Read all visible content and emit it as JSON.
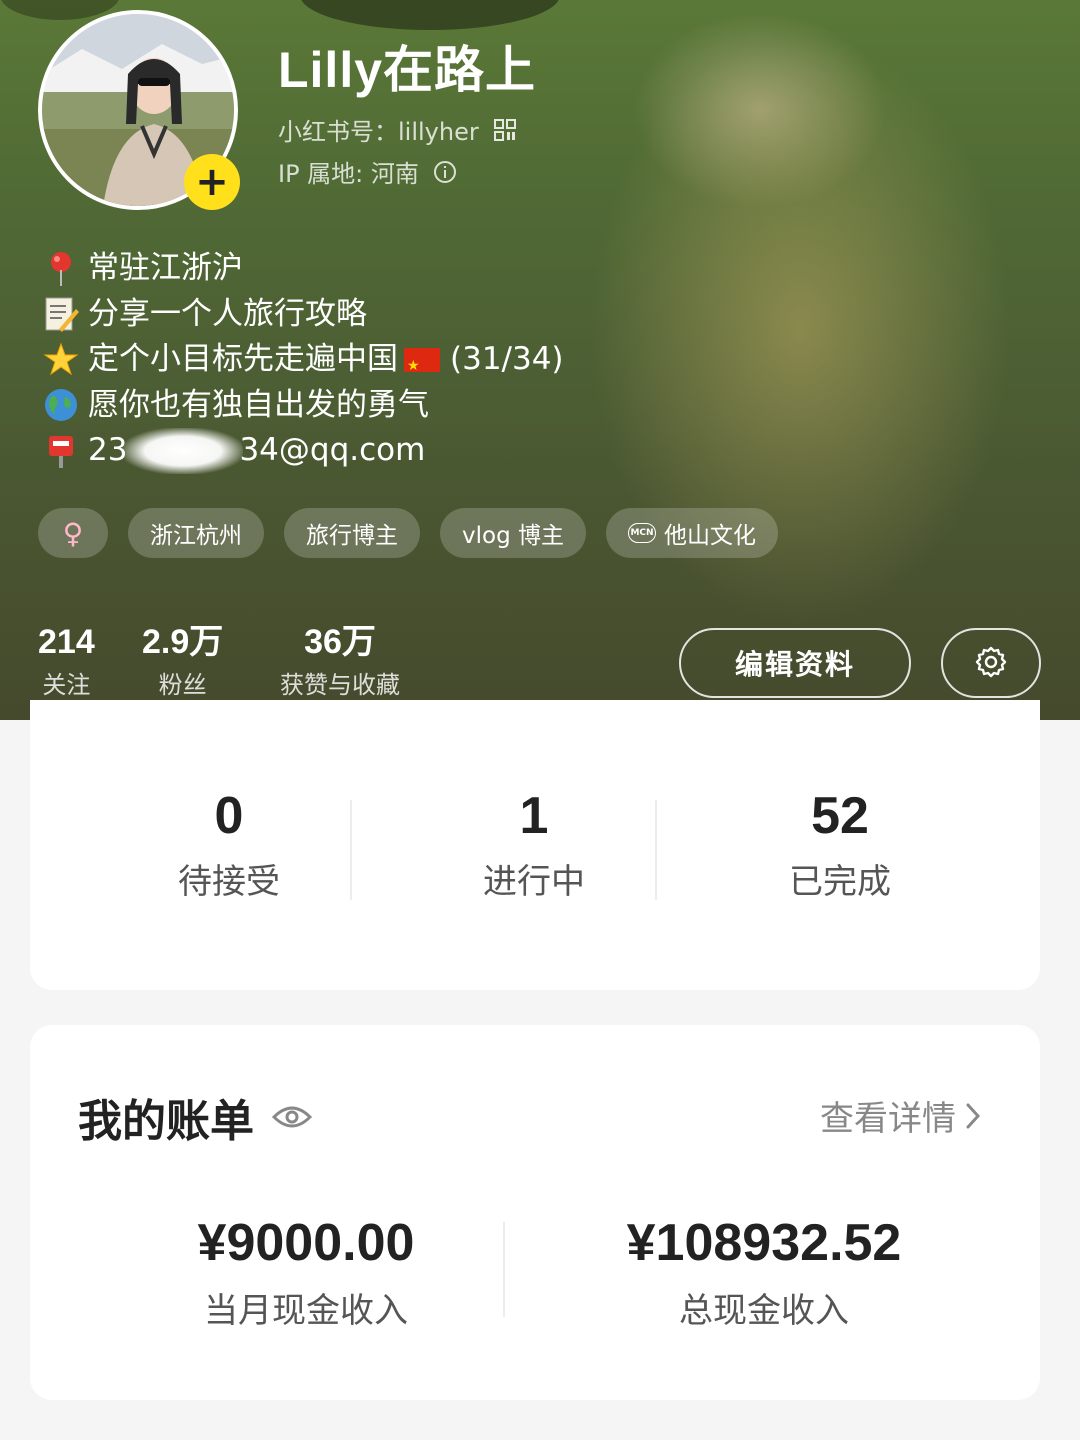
{
  "profile": {
    "name": "Lilly在路上",
    "id_line": "小红书号：lillyher",
    "ip_line": "IP 属地: 河南",
    "add_label": "+"
  },
  "bio": {
    "line1": "常驻江浙沪",
    "line2": "分享一个人旅行攻略",
    "line3_pre": "定个小目标先走遍中国",
    "line3_post": "(31/34)",
    "line4": "愿你也有独自出发的勇气",
    "email_pre": "23",
    "email_post": "34@qq.com"
  },
  "tags": {
    "gender": "♀",
    "t1": "浙江杭州",
    "t2": "旅行博主",
    "t3": "vlog 博主",
    "t4": "他山文化",
    "mcn_badge": "MCN"
  },
  "stats": {
    "follow_value": "214",
    "follow_label": "关注",
    "fans_value": "2.9万",
    "fans_label": "粉丝",
    "likes_value": "36万",
    "likes_label": "获赞与收藏"
  },
  "actions": {
    "edit_label": "编辑资料"
  },
  "tasks": {
    "pending_value": "0",
    "pending_label": "待接受",
    "progress_value": "1",
    "progress_label": "进行中",
    "done_value": "52",
    "done_label": "已完成"
  },
  "bill": {
    "title": "我的账单",
    "detail_label": "查看详情",
    "month_value": "¥9000.00",
    "month_label": "当月现金收入",
    "total_value": "¥108932.52",
    "total_label": "总现金收入"
  },
  "icons": {
    "qr": "qr-code-icon",
    "info": "info-icon",
    "pin": "pin-icon",
    "memo": "memo-icon",
    "star": "star-icon",
    "globe": "globe-icon",
    "mailbox": "mailbox-icon",
    "gear": "gear-icon",
    "eye": "eye-icon",
    "chevron": "chevron-right-icon"
  },
  "colors": {
    "accent_yellow": "#ffe01b",
    "header_green": "#56693a",
    "card_bg": "#ffffff",
    "page_bg": "#f5f5f5"
  }
}
